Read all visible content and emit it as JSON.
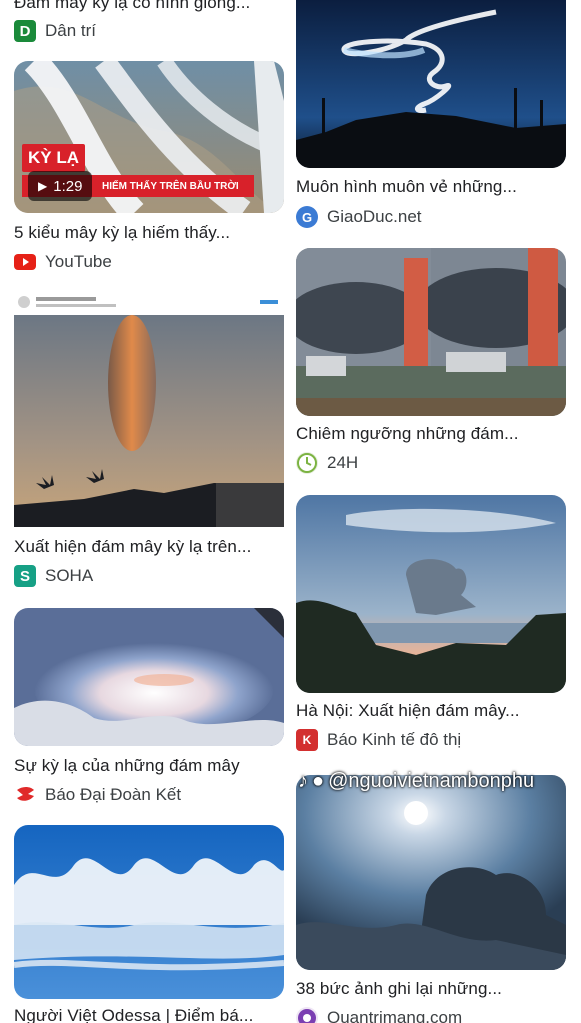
{
  "results": {
    "left": [
      {
        "title": "Đám mây kỳ lạ có hình giống...",
        "source": "Dân trí"
      },
      {
        "title": "5 kiểu mây kỳ lạ hiếm thấy...",
        "source": "YouTube",
        "video_duration": "1:29",
        "overlay_badge": "KỲ LẠ",
        "overlay_strip": "HIẾM THẤY TRÊN BẦU TRỜI"
      },
      {
        "title": "Xuất hiện đám mây kỳ lạ trên...",
        "source": "SOHA"
      },
      {
        "title": "Sự kỳ lạ của những đám mây",
        "source": "Báo Đại Đoàn Kết"
      },
      {
        "title": "Người Việt Odessa | Điểm bá...",
        "source": ""
      }
    ],
    "right": [
      {
        "title": "Muôn hình muôn vẻ những...",
        "source": "GiaoDuc.net"
      },
      {
        "title": "Chiêm ngưỡng những đám...",
        "source": "24H"
      },
      {
        "title": "Hà Nội: Xuất hiện đám mây...",
        "source": "Báo Kinh tế đô thị"
      },
      {
        "title": "38 bức ảnh ghi lại những...",
        "source": "Quantrimang.com"
      }
    ]
  },
  "watermark": "@nguoivietnambonphu",
  "colors": {
    "youtube_red": "#e62117",
    "danti_green": "#1a8a3a",
    "soha_teal": "#16a085"
  }
}
